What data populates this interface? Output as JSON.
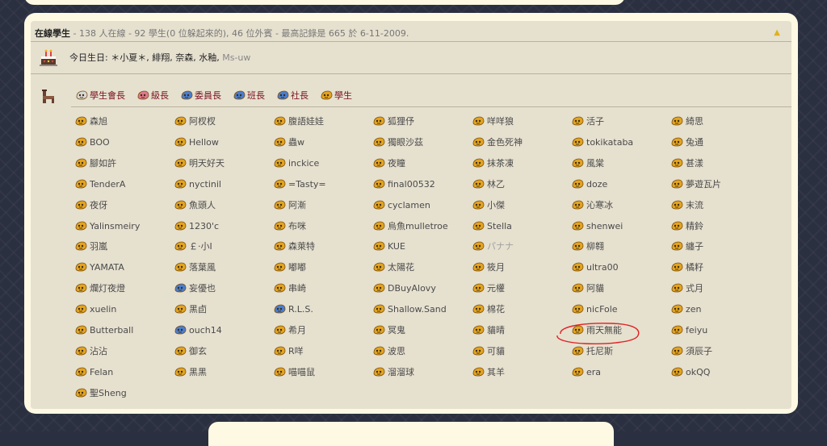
{
  "online": {
    "title": "在線學生",
    "stats": " - 138 人在線 - 92 學生(0 位躲起來的), 46 位外賓 - 最高記錄是 665 於 6-11-2009."
  },
  "birthday": {
    "label": "今日生日:",
    "names": "＊小夏＊, 緋翔, 奈森, 水釉,",
    "names_gray": "Ms-uw"
  },
  "legend": [
    {
      "label": "學生會長",
      "color": "#d8d8d8"
    },
    {
      "label": "級長",
      "color": "#e07890"
    },
    {
      "label": "委員長",
      "color": "#4a7ed0"
    },
    {
      "label": "班長",
      "color": "#4a7ed0"
    },
    {
      "label": "社長",
      "color": "#4a7ed0"
    },
    {
      "label": "學生",
      "color": "#e3a420"
    }
  ],
  "colors": {
    "student_icon": "#e3a420",
    "blue_icon": "#4a7ed0",
    "name_text": "#4a4a4a",
    "name_gray": "#a0a0a0",
    "highlight": "#e02020"
  },
  "users": [
    [
      {
        "name": "森旭"
      },
      {
        "name": "BOO"
      },
      {
        "name": "腳如許"
      },
      {
        "name": "TenderA"
      },
      {
        "name": "夜伢"
      },
      {
        "name": "Yalinsmeiry"
      },
      {
        "name": "羽嵐"
      },
      {
        "name": "YAMATA"
      },
      {
        "name": "爛灯夜燈"
      },
      {
        "name": "xuelin"
      },
      {
        "name": "Butterball"
      },
      {
        "name": "沾沾"
      },
      {
        "name": "Felan"
      },
      {
        "name": "聖Sheng"
      }
    ],
    [
      {
        "name": "阿杈杈"
      },
      {
        "name": "Hellow"
      },
      {
        "name": "明天好天"
      },
      {
        "name": "nyctinil"
      },
      {
        "name": "魚頭人"
      },
      {
        "name": "1230'c"
      },
      {
        "name": "￡·小I"
      },
      {
        "name": "落葉風"
      },
      {
        "name": "妄優也",
        "icon": "blue"
      },
      {
        "name": "黑卣"
      },
      {
        "name": "ouch14",
        "icon": "blue"
      },
      {
        "name": "御玄"
      },
      {
        "name": "黑黑"
      }
    ],
    [
      {
        "name": "腹語娃娃"
      },
      {
        "name": "蟲w"
      },
      {
        "name": "inckice"
      },
      {
        "name": "=Tasty="
      },
      {
        "name": "阿漸"
      },
      {
        "name": "布咪"
      },
      {
        "name": "森萊特"
      },
      {
        "name": "嘟嘟"
      },
      {
        "name": "串崎"
      },
      {
        "name": "R.L.S.",
        "icon": "blue"
      },
      {
        "name": "希月"
      },
      {
        "name": "R咩"
      },
      {
        "name": "喵喵鼠"
      }
    ],
    [
      {
        "name": "狐狸伃"
      },
      {
        "name": "獨眼沙茲"
      },
      {
        "name": "夜瞳"
      },
      {
        "name": "final00532"
      },
      {
        "name": "cyclamen"
      },
      {
        "name": "烏魚mulletroe"
      },
      {
        "name": "KUE"
      },
      {
        "name": "太陽花"
      },
      {
        "name": "DBuyAlovy"
      },
      {
        "name": "Shallow.Sand"
      },
      {
        "name": "冥鬼"
      },
      {
        "name": "波思"
      },
      {
        "name": "溜溜球"
      }
    ],
    [
      {
        "name": "咩咩狼"
      },
      {
        "name": "金色死神"
      },
      {
        "name": "抹茶凍"
      },
      {
        "name": "林乙"
      },
      {
        "name": "小傑"
      },
      {
        "name": "Stella"
      },
      {
        "name": "パナナ",
        "gray": true
      },
      {
        "name": "筱月"
      },
      {
        "name": "元權"
      },
      {
        "name": "棉花"
      },
      {
        "name": "貓晴"
      },
      {
        "name": "可貓"
      },
      {
        "name": "其羊"
      }
    ],
    [
      {
        "name": "活子"
      },
      {
        "name": "tokikataba"
      },
      {
        "name": "風棠"
      },
      {
        "name": "doze"
      },
      {
        "name": "沁寒冰"
      },
      {
        "name": "shenwei"
      },
      {
        "name": "柳翱"
      },
      {
        "name": "ultra00"
      },
      {
        "name": "阿貓"
      },
      {
        "name": "nicFole"
      },
      {
        "name": "雨天無能"
      },
      {
        "name": "托尼斯"
      },
      {
        "name": "era"
      }
    ],
    [
      {
        "name": "綺思"
      },
      {
        "name": "兔通"
      },
      {
        "name": "甚漾"
      },
      {
        "name": "夢遊瓦片"
      },
      {
        "name": "末流"
      },
      {
        "name": "精鈴"
      },
      {
        "name": "纏子"
      },
      {
        "name": "橘籽"
      },
      {
        "name": "式月"
      },
      {
        "name": "zen"
      },
      {
        "name": "feiyu"
      },
      {
        "name": "須辰子"
      },
      {
        "name": "okQQ"
      }
    ]
  ]
}
